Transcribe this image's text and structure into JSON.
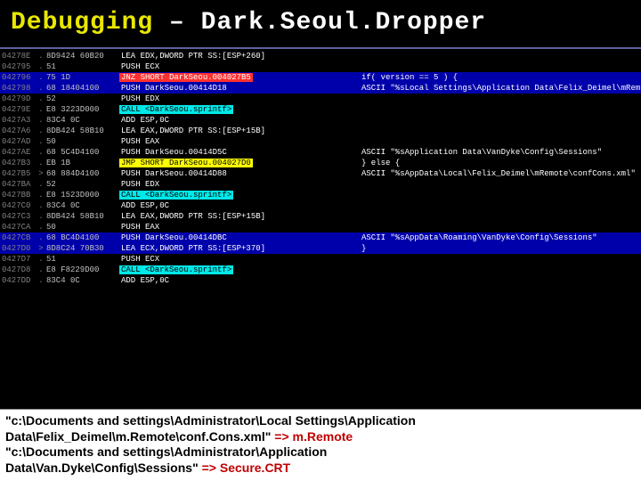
{
  "title": {
    "t1": "Debugging",
    "dash": " – ",
    "t2": "Dark.Seoul.Dropper"
  },
  "rows": [
    {
      "a": "04278E",
      "s": ".",
      "h": "8D9424 60B20",
      "i": "LEA EDX,DWORD PTR SS:[ESP+260]",
      "hl": "",
      "c": ""
    },
    {
      "a": "042795",
      "s": ".",
      "h": "51",
      "i": "PUSH ECX",
      "hl": "",
      "c": ""
    },
    {
      "a": "042796",
      "s": ".",
      "h": "75 1D",
      "i": "JNZ SHORT DarkSeou.004027B5",
      "hl": "red",
      "c": "if( version == 5 ) {",
      "sel": true
    },
    {
      "a": "042798",
      "s": ".",
      "h": "68 18404100",
      "i": "PUSH DarkSeou.00414D18",
      "hl": "",
      "c": "ASCII \"%sLocal Settings\\Application Data\\Felix_Deimel\\mRem",
      "sel": true
    },
    {
      "a": "04279D",
      "s": ".",
      "h": "52",
      "i": "PUSH EDX",
      "hl": "",
      "c": ""
    },
    {
      "a": "04279E",
      "s": ".",
      "h": "E8 3223D000",
      "i": "CALL <DarkSeou.sprintf>",
      "hl": "cyan",
      "c": ""
    },
    {
      "a": "0427A3",
      "s": ".",
      "h": "83C4 0C",
      "i": "ADD ESP,0C",
      "hl": "",
      "c": ""
    },
    {
      "a": "0427A6",
      "s": ".",
      "h": "8DB424 58B10",
      "i": "LEA EAX,DWORD PTR SS:[ESP+15B]",
      "hl": "",
      "c": ""
    },
    {
      "a": "0427AD",
      "s": ".",
      "h": "50",
      "i": "PUSH EAX",
      "hl": "",
      "c": ""
    },
    {
      "a": "0427AE",
      "s": ".",
      "h": "68 5C4D4100",
      "i": "PUSH DarkSeou.00414D5C",
      "hl": "",
      "c": "ASCII \"%sApplication Data\\VanDyke\\Config\\Sessions\""
    },
    {
      "a": "0427B3",
      "s": ".",
      "h": "EB 1B",
      "i": "JMP SHORT DarkSeou.004027D0",
      "hl": "yellow",
      "c": "} else {"
    },
    {
      "a": "0427B5",
      "s": ">",
      "h": "68 884D4100",
      "i": "PUSH DarkSeou.00414D88",
      "hl": "",
      "c": "ASCII \"%sAppData\\Local\\Felix_Deimel\\mRemote\\confCons.xml\""
    },
    {
      "a": "0427BA",
      "s": ".",
      "h": "52",
      "i": "PUSH EDX",
      "hl": "",
      "c": ""
    },
    {
      "a": "0427BB",
      "s": ".",
      "h": "E8 1523D000",
      "i": "CALL <DarkSeou.sprintf>",
      "hl": "cyan",
      "c": ""
    },
    {
      "a": "0427C0",
      "s": ".",
      "h": "83C4 0C",
      "i": "ADD ESP,0C",
      "hl": "",
      "c": ""
    },
    {
      "a": "0427C3",
      "s": ".",
      "h": "8DB424 58B10",
      "i": "LEA EAX,DWORD PTR SS:[ESP+15B]",
      "hl": "",
      "c": ""
    },
    {
      "a": "0427CA",
      "s": ".",
      "h": "50",
      "i": "PUSH EAX",
      "hl": "",
      "c": ""
    },
    {
      "a": "0427CB",
      "s": ".",
      "h": "68 BC4D4100",
      "i": "PUSH DarkSeou.00414DBC",
      "hl": "",
      "c": "ASCII \"%sAppData\\Roaming\\VanDyke\\Config\\Sessions\"",
      "sel": true
    },
    {
      "a": "0427D0",
      "s": ">",
      "h": "8D8C24 70B30",
      "i": "LEA ECX,DWORD PTR SS:[ESP+370]",
      "hl": "",
      "c": "}",
      "sel": true
    },
    {
      "a": "0427D7",
      "s": ".",
      "h": "51",
      "i": "PUSH ECX",
      "hl": "",
      "c": ""
    },
    {
      "a": "0427D8",
      "s": ".",
      "h": "E8 F8229D00",
      "i": "CALL <DarkSeou.sprintf>",
      "hl": "cyan",
      "c": ""
    },
    {
      "a": "0427DD",
      "s": ".",
      "h": "83C4 0C",
      "i": "ADD ESP,0C",
      "hl": "",
      "c": ""
    }
  ],
  "footer": {
    "l1a": "\"c:\\Documents and settings\\Administrator\\Local Settings\\Application",
    "l2a": "Data\\Felix_Deimel\\m.Remote\\conf.Cons.xml\"",
    "arrow": " => ",
    "r1": "m.Remote",
    "l3a": "\"c:\\Documents and settings\\Administrator\\Application",
    "l4a": "Data\\Van.Dyke\\Config\\Sessions\"",
    "r2": "Secure.CRT"
  }
}
